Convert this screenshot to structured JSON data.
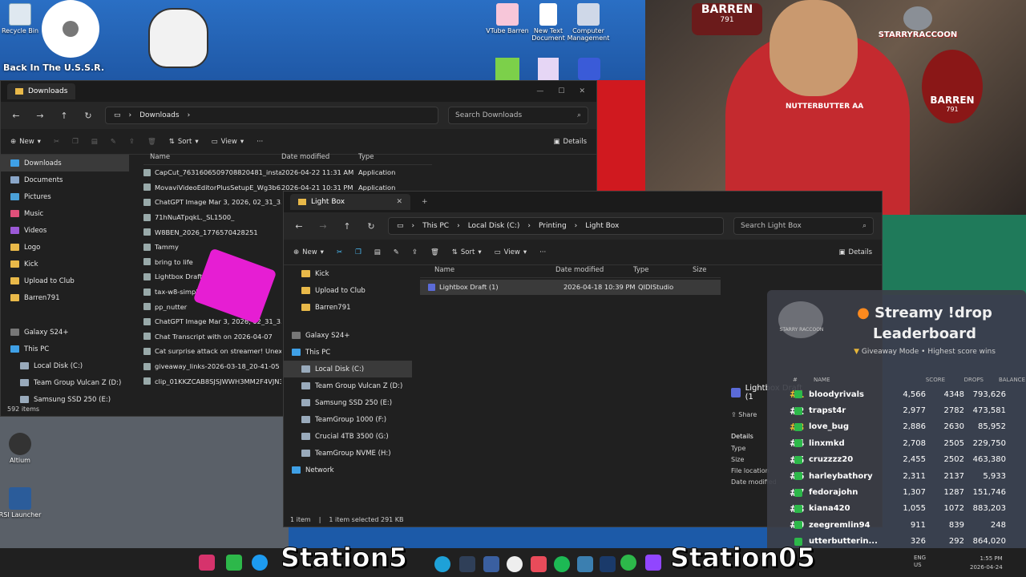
{
  "desktop": {
    "icons": [
      {
        "label": "Recycle Bin"
      },
      {
        "label": "VTube Barren"
      },
      {
        "label": "New Text Document"
      },
      {
        "label": "Computer Management"
      },
      {
        "label": "Altium"
      },
      {
        "label": "RSI Launcher"
      }
    ],
    "stream_title": "Back In The U.S.S.R."
  },
  "downloads_window": {
    "tab_label": "Downloads",
    "address": "Downloads",
    "search_placeholder": "Search Downloads",
    "cmd": {
      "new": "New",
      "sort": "Sort",
      "view": "View",
      "more": "···",
      "details": "Details"
    },
    "sidebar": [
      "Downloads",
      "Documents",
      "Pictures",
      "Music",
      "Videos",
      "Logo",
      "Kick",
      "Upload to Club",
      "Barren791",
      "Galaxy S24+",
      "This PC",
      "Local Disk (C:)",
      "Team Group Vulcan Z (D:)",
      "Samsung SSD 250 (E:)"
    ],
    "columns": {
      "name": "Name",
      "date": "Date modified",
      "type": "Type"
    },
    "files": [
      {
        "name": "CapCut_7631606509708820481_installer",
        "date": "2026-04-22 11:31 AM",
        "type": "Application"
      },
      {
        "name": "MovaviVideoEditorPlusSetupE_Wg3b63n_",
        "date": "2026-04-21 10:31 PM",
        "type": "Application"
      },
      {
        "name": "ChatGPT Image Mar 3, 2026, 02_31_35 AM",
        "date": "",
        "type": ""
      },
      {
        "name": "71hNuATpqkL._SL1500_",
        "date": "",
        "type": ""
      },
      {
        "name": "W8BEN_2026_1776570428251",
        "date": "",
        "type": ""
      },
      {
        "name": "Tammy",
        "date": "",
        "type": ""
      },
      {
        "name": "bring to life",
        "date": "",
        "type": ""
      },
      {
        "name": "Lightbox Draft",
        "date": "",
        "type": ""
      },
      {
        "name": "tax-w8-simple-202",
        "date": "",
        "type": ""
      },
      {
        "name": "pp_nutter",
        "date": "",
        "type": ""
      },
      {
        "name": "ChatGPT Image Mar 3, 2026, 02_31_35 AM",
        "date": "",
        "type": ""
      },
      {
        "name": "Chat Transcript with  on 2026-04-07",
        "date": "",
        "type": ""
      },
      {
        "name": "Cat surprise attack on streamer! Unexpec...",
        "date": "",
        "type": ""
      },
      {
        "name": "giveaway_links-2026-03-18_20-41-05",
        "date": "",
        "type": ""
      },
      {
        "name": "clip_01KKZCAB8SJSJWWH3MM2F4VJN3",
        "date": "",
        "type": ""
      }
    ],
    "status": "592 items"
  },
  "lightbox_window": {
    "tab_label": "Light Box",
    "breadcrumb": [
      "This PC",
      "Local Disk (C:)",
      "Printing",
      "Light Box"
    ],
    "search_placeholder": "Search Light Box",
    "cmd": {
      "new": "New",
      "sort": "Sort",
      "view": "View",
      "more": "···",
      "details": "Details"
    },
    "sidebar": [
      "Kick",
      "Upload to Club",
      "Barren791",
      "Galaxy S24+",
      "This PC",
      "Local Disk (C:)",
      "Team Group Vulcan Z (D:)",
      "Samsung SSD 250 (E:)",
      "TeamGroup 1000 (F:)",
      "Crucial 4TB 3500 (G:)",
      "TeamGroup NVME (H:)",
      "Network"
    ],
    "columns": {
      "name": "Name",
      "date": "Date modified",
      "type": "Type",
      "size": "Size"
    },
    "files": [
      {
        "name": "Lightbox Draft (1)",
        "date": "2026-04-18 10:39 PM",
        "type": "QIDIStudio"
      }
    ],
    "status": {
      "count": "1 item",
      "selected": "1 item selected  291 KB"
    },
    "details_pane": {
      "file": "Lightbox Draft (1",
      "share": "Share",
      "heading": "Details",
      "fields": [
        "Type",
        "Size",
        "File location",
        "Date modified"
      ]
    }
  },
  "leaderboard": {
    "brand": "STARRY RACCOON",
    "title_line1": "Streamy !drop",
    "title_line2": "Leaderboard",
    "subtitle": "Giveaway Mode • Highest score wins",
    "headers": {
      "rank": "#",
      "name": "NAME",
      "score": "SCORE",
      "drops": "DROPS",
      "balance": "BALANCE"
    },
    "rows": [
      {
        "rank": "#1",
        "name": "bloodyrivals",
        "score": "4,566",
        "drops": "4348",
        "balance": "793,626"
      },
      {
        "rank": "#2",
        "name": "trapst4r",
        "score": "2,977",
        "drops": "2782",
        "balance": "473,581"
      },
      {
        "rank": "#3",
        "name": "love_bug",
        "score": "2,886",
        "drops": "2630",
        "balance": "85,952"
      },
      {
        "rank": "#4",
        "name": "linxmkd",
        "score": "2,708",
        "drops": "2505",
        "balance": "229,750"
      },
      {
        "rank": "#5",
        "name": "cruzzzz20",
        "score": "2,455",
        "drops": "2502",
        "balance": "463,380"
      },
      {
        "rank": "#6",
        "name": "harleybathory",
        "score": "2,311",
        "drops": "2137",
        "balance": "5,933"
      },
      {
        "rank": "#7",
        "name": "fedorajohn",
        "score": "1,307",
        "drops": "1287",
        "balance": "151,746"
      },
      {
        "rank": "#8",
        "name": "kiana420",
        "score": "1,055",
        "drops": "1072",
        "balance": "883,203"
      },
      {
        "rank": "#9",
        "name": "zeegremlin94",
        "score": "911",
        "drops": "839",
        "balance": "248"
      },
      {
        "rank": "",
        "name": "utterbutterin...",
        "score": "326",
        "drops": "292",
        "balance": "864,020"
      }
    ]
  },
  "overlay": {
    "logo_top": "BARREN",
    "logo_top_sub": "791",
    "starry": "STARRYRACCOON",
    "barren_right": "BARREN",
    "barren_right_sub": "791",
    "shirt": "NUTTERBUTTER AA",
    "banner_left": "Station5",
    "banner_right": "Station05"
  },
  "taskbar": {
    "lang": "ENG",
    "region": "US",
    "time": "1:55 PM",
    "date": "2026-04-24"
  },
  "colors": {
    "accent": "#4cc2ff",
    "folder": "#e9b949",
    "kick": "#2db84a",
    "twitch": "#9146ff"
  }
}
